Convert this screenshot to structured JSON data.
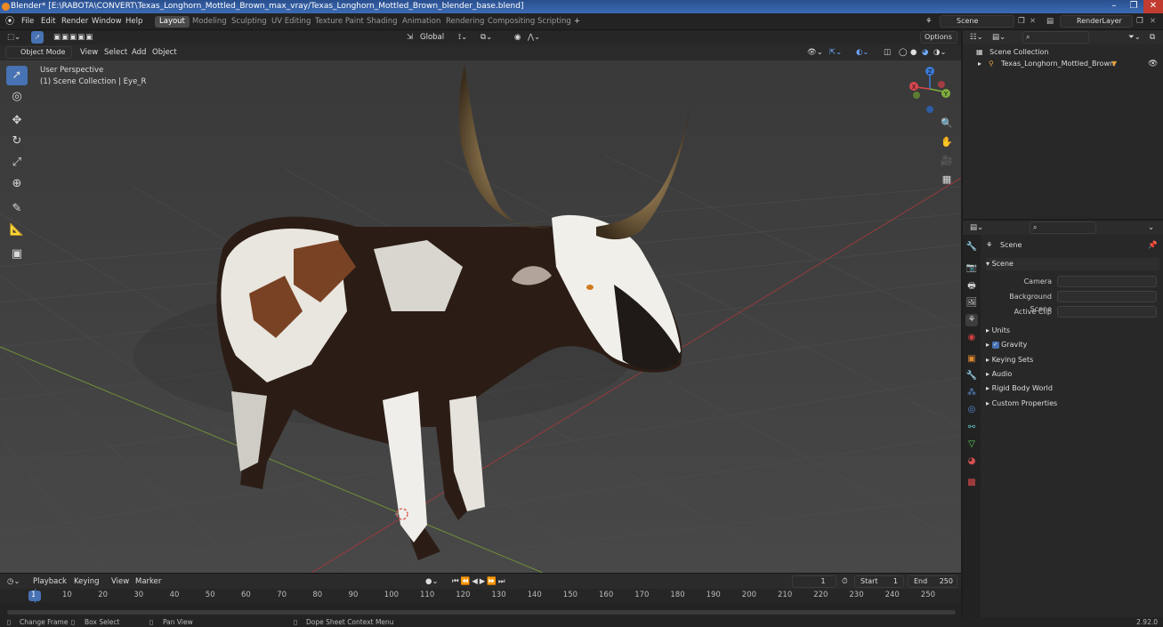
{
  "window": {
    "title": "Blender* [E:\\RABOTA\\CONVERT\\Texas_Longhorn_Mottled_Brown_max_vray/Texas_Longhorn_Mottled_Brown_blender_base.blend]",
    "minimize": "–",
    "maximize": "❐",
    "close": "✕"
  },
  "menu": {
    "items": [
      "File",
      "Edit",
      "Render",
      "Window",
      "Help"
    ]
  },
  "workspaces": [
    "Layout",
    "Modeling",
    "Sculpting",
    "UV Editing",
    "Texture Paint",
    "Shading",
    "Animation",
    "Rendering",
    "Compositing",
    "Scripting"
  ],
  "workspace_add": "+",
  "scene": {
    "label": "Scene",
    "render_layer": "RenderLayer"
  },
  "viewport": {
    "mode": "Object Mode",
    "menus": [
      "View",
      "Select",
      "Add",
      "Object"
    ],
    "transform_orientation": "Global",
    "options_label": "Options",
    "perspective_label": "User Perspective",
    "collection_label": "(1) Scene Collection | Eye_R",
    "gizmo": {
      "x": "X",
      "y": "Y",
      "z": "Z"
    },
    "axis_colors": {
      "x": "#d8474f",
      "y": "#7fae3e",
      "z": "#3a7ad8"
    }
  },
  "timeline": {
    "menus": [
      "Playback",
      "Keying",
      "View",
      "Marker"
    ],
    "current_frame": "1",
    "start_label": "Start",
    "start": "1",
    "end_label": "End",
    "end": "250",
    "ticks": [
      "1",
      "10",
      "20",
      "30",
      "40",
      "50",
      "60",
      "70",
      "80",
      "90",
      "100",
      "110",
      "120",
      "130",
      "140",
      "150",
      "160",
      "170",
      "180",
      "190",
      "200",
      "210",
      "220",
      "230",
      "240",
      "250"
    ]
  },
  "outliner": {
    "root": "Scene Collection",
    "items": [
      {
        "label": "Texas_Longhorn_Mottled_Brown"
      }
    ]
  },
  "properties": {
    "context": "Scene",
    "panel": "Scene",
    "fields": [
      {
        "label": "Camera",
        "value": ""
      },
      {
        "label": "Background Scene",
        "value": ""
      },
      {
        "label": "Active Clip",
        "value": ""
      }
    ],
    "sections": [
      "Units",
      "Gravity",
      "Keying Sets",
      "Audio",
      "Rigid Body World",
      "Custom Properties"
    ],
    "gravity_checked": true
  },
  "statusbar": {
    "items": [
      "Change Frame",
      "Box Select",
      "Pan View",
      "Dope Sheet Context Menu"
    ],
    "version": "2.92.0"
  }
}
